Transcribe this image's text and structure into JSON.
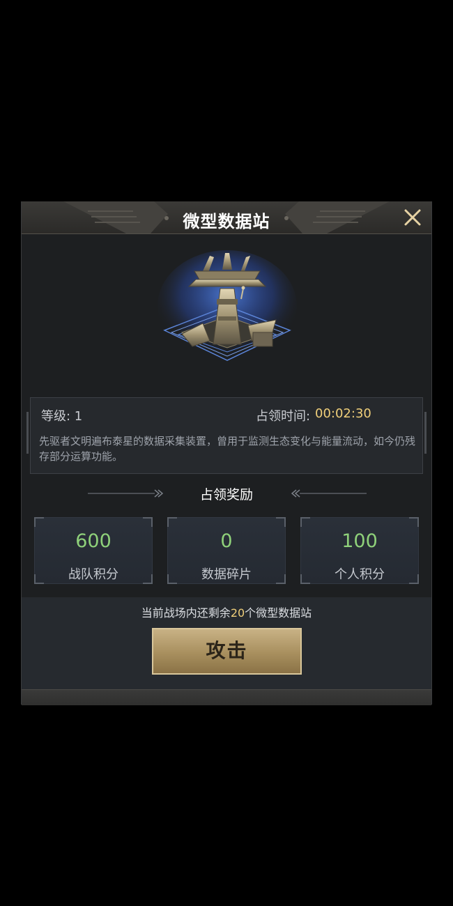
{
  "dialog": {
    "title": "微型数据站",
    "close_icon": "close-icon"
  },
  "station": {
    "image_icon": "data-station-tower-icon",
    "level_text": "等级: 1",
    "occupy_label": "占领时间:",
    "occupy_time": "00:02:30",
    "description": "先驱者文明遍布泰星的数据采集装置，曾用于监测生态变化与能量流动，如今仍残存部分运算功能。"
  },
  "rewards": {
    "title": "占领奖励",
    "items": [
      {
        "value": "600",
        "label": "战队积分"
      },
      {
        "value": "0",
        "label": "数据碎片"
      },
      {
        "value": "100",
        "label": "个人积分"
      }
    ]
  },
  "footer": {
    "remaining_prefix": "当前战场内还剩余",
    "remaining_count": "20",
    "remaining_suffix": "个微型数据站",
    "attack_label": "攻击"
  },
  "colors": {
    "background": "#000000",
    "panel": "#1d1f21",
    "accent_gold": "#f0cf7a",
    "reward_green": "#8fd17a",
    "button_gold": "#b59c6b"
  }
}
